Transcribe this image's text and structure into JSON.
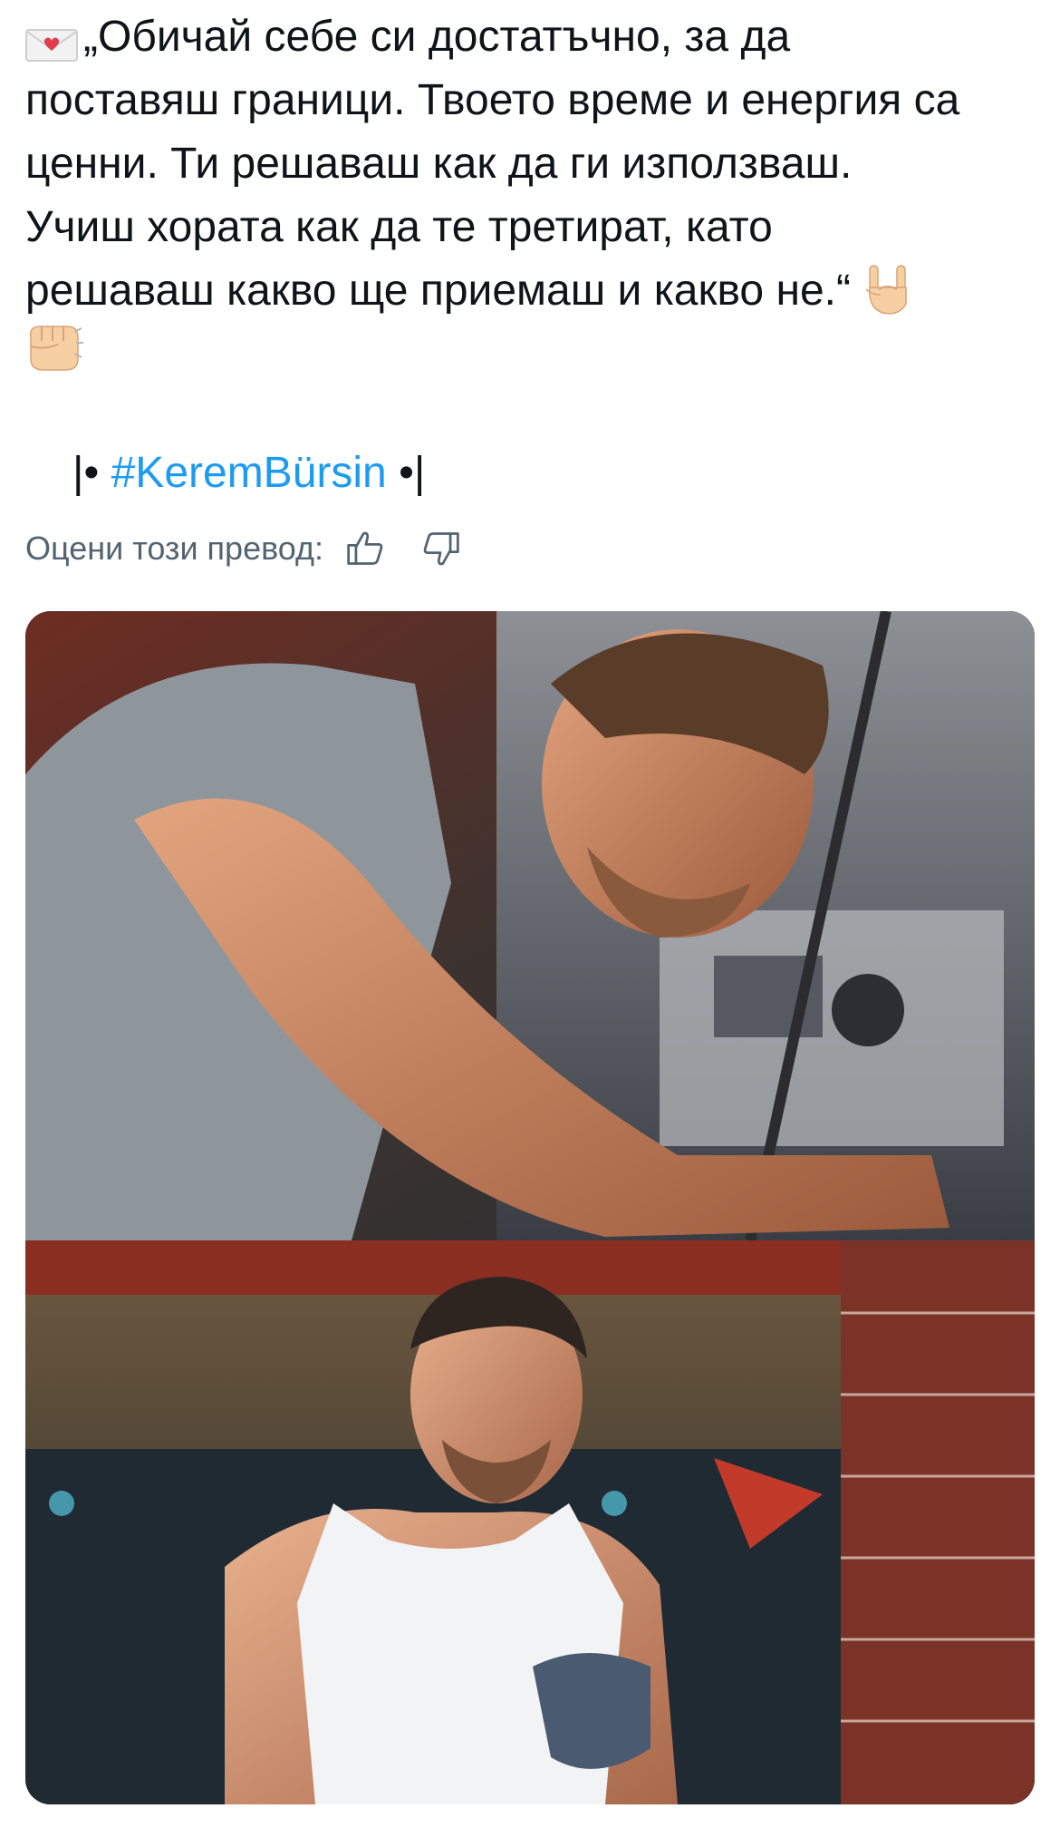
{
  "post": {
    "lines": [
      "„Обичай себе си достатъчно, за да",
      "поставяш граници. Твоето време и енергия са",
      "ценни. Ти решаваш как да ги използваш.",
      "Учиш хората как да те третират, като",
      "решаваш какво ще приемаш и какво не.“"
    ],
    "leading_emoji": "love-letter-icon",
    "trailing_emojis": [
      "rock-on-hand-icon",
      "fist-bump-icon"
    ],
    "hashtag_prefix": "|• ",
    "hashtag": "#KeremBürsin",
    "hashtag_suffix": " •|"
  },
  "translation_rating": {
    "label": "Оцени този превод:",
    "like_icon": "thumbs-up-icon",
    "dislike_icon": "thumbs-down-icon"
  },
  "media": {
    "photos": [
      {
        "name": "photo-man-working-on-car-engine",
        "kind": "image"
      },
      {
        "name": "photo-man-in-white-tank-top-garage",
        "kind": "image"
      }
    ]
  },
  "colors": {
    "text": "#0f1419",
    "secondary_text": "#536471",
    "hashtag": "#1d9bf0",
    "background": "#ffffff"
  }
}
